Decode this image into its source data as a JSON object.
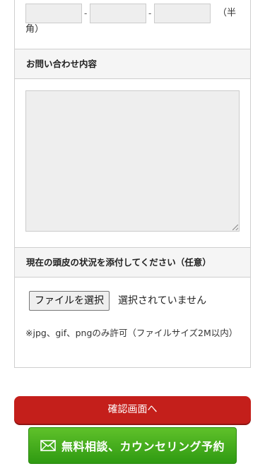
{
  "phone": {
    "separator": "-",
    "note_line1": "（半",
    "note_line2": "角）"
  },
  "inquiry": {
    "label": "お問い合わせ内容",
    "value": ""
  },
  "attachment": {
    "label": "現在の頭皮の状況を添付してください（任意）",
    "button_label": "ファイルを選択",
    "status": "選択されていません",
    "note": "※jpg、gif、pngのみ許可（ファイルサイズ2M以内）"
  },
  "actions": {
    "confirm_label": "確認画面へ",
    "consult_label": "無料相談、カウンセリング予約",
    "consult_icon": "mail-icon"
  }
}
